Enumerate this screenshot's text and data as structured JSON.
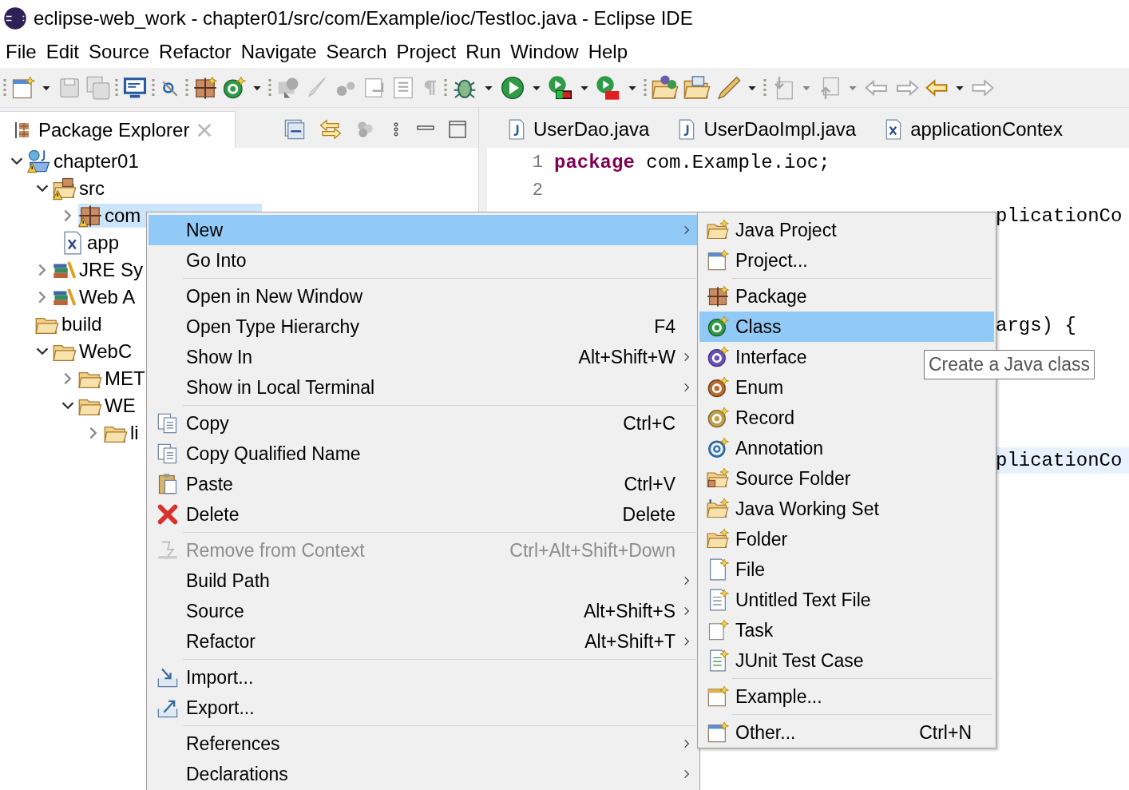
{
  "window": {
    "title": "eclipse-web_work - chapter01/src/com/Example/ioc/TestIoc.java - Eclipse IDE"
  },
  "menu_bar": [
    "File",
    "Edit",
    "Source",
    "Refactor",
    "Navigate",
    "Search",
    "Project",
    "Run",
    "Window",
    "Help"
  ],
  "package_explorer": {
    "title": "Package Explorer",
    "tree": [
      {
        "label": "chapter01",
        "expanded": true,
        "selected": false,
        "children": [
          {
            "label": "src",
            "expanded": true,
            "selected": false,
            "children": [
              {
                "label": "com",
                "expanded": false,
                "selected": true
              },
              {
                "label": "app",
                "selected": false
              }
            ]
          },
          {
            "label": "JRE Sy",
            "expanded": false,
            "selected": false
          },
          {
            "label": "Web A",
            "expanded": false,
            "selected": false
          },
          {
            "label": "build",
            "selected": false
          },
          {
            "label": "WebC",
            "expanded": true,
            "selected": false,
            "children": [
              {
                "label": "MET",
                "expanded": false,
                "selected": false
              },
              {
                "label": "WE",
                "expanded": true,
                "selected": false,
                "children": [
                  {
                    "label": "li",
                    "expanded": false,
                    "selected": false
                  }
                ]
              }
            ]
          }
        ]
      }
    ]
  },
  "editor": {
    "tabs": [
      {
        "label": "UserDao.java",
        "selected": false
      },
      {
        "label": "UserDaoImpl.java",
        "selected": false
      },
      {
        "label": "applicationContex",
        "selected": false
      }
    ],
    "lines": [
      {
        "number": "1",
        "keyword": "package",
        "text": " com.Example.ioc;"
      },
      {
        "number": "2"
      }
    ],
    "visible_fragments": [
      {
        "text": "plicationCo",
        "highlighted": false
      },
      {
        "text": "args) {",
        "highlighted": false
      },
      {
        "text": "plicationCo",
        "highlighted": true
      }
    ]
  },
  "context_menu": {
    "items": [
      {
        "kind": "item",
        "label": "New",
        "submenu": true,
        "selected": true,
        "disabled": false
      },
      {
        "kind": "item",
        "label": "Go Into",
        "submenu": false,
        "selected": false,
        "disabled": false
      },
      {
        "kind": "separator"
      },
      {
        "kind": "item",
        "label": "Open in New Window",
        "submenu": false,
        "selected": false,
        "disabled": false
      },
      {
        "kind": "item",
        "label": "Open Type Hierarchy",
        "shortcut": "F4",
        "submenu": false,
        "selected": false,
        "disabled": false
      },
      {
        "kind": "item",
        "label": "Show In",
        "shortcut": "Alt+Shift+W",
        "submenu": true,
        "selected": false,
        "disabled": false
      },
      {
        "kind": "item",
        "label": "Show in Local Terminal",
        "submenu": true,
        "selected": false,
        "disabled": false
      },
      {
        "kind": "separator"
      },
      {
        "kind": "item",
        "label": "Copy",
        "shortcut": "Ctrl+C",
        "submenu": false,
        "selected": false,
        "disabled": false
      },
      {
        "kind": "item",
        "label": "Copy Qualified Name",
        "submenu": false,
        "selected": false,
        "disabled": false
      },
      {
        "kind": "item",
        "label": "Paste",
        "shortcut": "Ctrl+V",
        "submenu": false,
        "selected": false,
        "disabled": false
      },
      {
        "kind": "item",
        "label": "Delete",
        "shortcut": "Delete",
        "submenu": false,
        "selected": false,
        "disabled": false
      },
      {
        "kind": "separator"
      },
      {
        "kind": "item",
        "label": "Remove from Context",
        "shortcut": "Ctrl+Alt+Shift+Down",
        "submenu": false,
        "selected": false,
        "disabled": true
      },
      {
        "kind": "item",
        "label": "Build Path",
        "submenu": true,
        "selected": false,
        "disabled": false
      },
      {
        "kind": "item",
        "label": "Source",
        "shortcut": "Alt+Shift+S",
        "submenu": true,
        "selected": false,
        "disabled": false
      },
      {
        "kind": "item",
        "label": "Refactor",
        "shortcut": "Alt+Shift+T",
        "submenu": true,
        "selected": false,
        "disabled": false
      },
      {
        "kind": "separator"
      },
      {
        "kind": "item",
        "label": "Import...",
        "submenu": false,
        "selected": false,
        "disabled": false
      },
      {
        "kind": "item",
        "label": "Export...",
        "submenu": false,
        "selected": false,
        "disabled": false
      },
      {
        "kind": "separator"
      },
      {
        "kind": "item",
        "label": "References",
        "submenu": true,
        "selected": false,
        "disabled": false
      },
      {
        "kind": "item",
        "label": "Declarations",
        "submenu": true,
        "selected": false,
        "disabled": false
      }
    ]
  },
  "new_submenu": {
    "items": [
      {
        "kind": "item",
        "label": "Java Project",
        "selected": false
      },
      {
        "kind": "item",
        "label": "Project...",
        "selected": false
      },
      {
        "kind": "separator"
      },
      {
        "kind": "item",
        "label": "Package",
        "selected": false
      },
      {
        "kind": "item",
        "label": "Class",
        "selected": true
      },
      {
        "kind": "item",
        "label": "Interface",
        "selected": false
      },
      {
        "kind": "item",
        "label": "Enum",
        "selected": false
      },
      {
        "kind": "item",
        "label": "Record",
        "selected": false
      },
      {
        "kind": "item",
        "label": "Annotation",
        "selected": false
      },
      {
        "kind": "item",
        "label": "Source Folder",
        "selected": false
      },
      {
        "kind": "item",
        "label": "Java Working Set",
        "selected": false
      },
      {
        "kind": "item",
        "label": "Folder",
        "selected": false
      },
      {
        "kind": "item",
        "label": "File",
        "selected": false
      },
      {
        "kind": "item",
        "label": "Untitled Text File",
        "selected": false
      },
      {
        "kind": "item",
        "label": "Task",
        "selected": false
      },
      {
        "kind": "item",
        "label": "JUnit Test Case",
        "selected": false
      },
      {
        "kind": "separator"
      },
      {
        "kind": "item",
        "label": "Example...",
        "selected": false
      },
      {
        "kind": "separator"
      },
      {
        "kind": "item",
        "label": "Other...",
        "shortcut": "Ctrl+N",
        "selected": false
      }
    ]
  },
  "tooltip": {
    "text": "Create a Java class"
  }
}
